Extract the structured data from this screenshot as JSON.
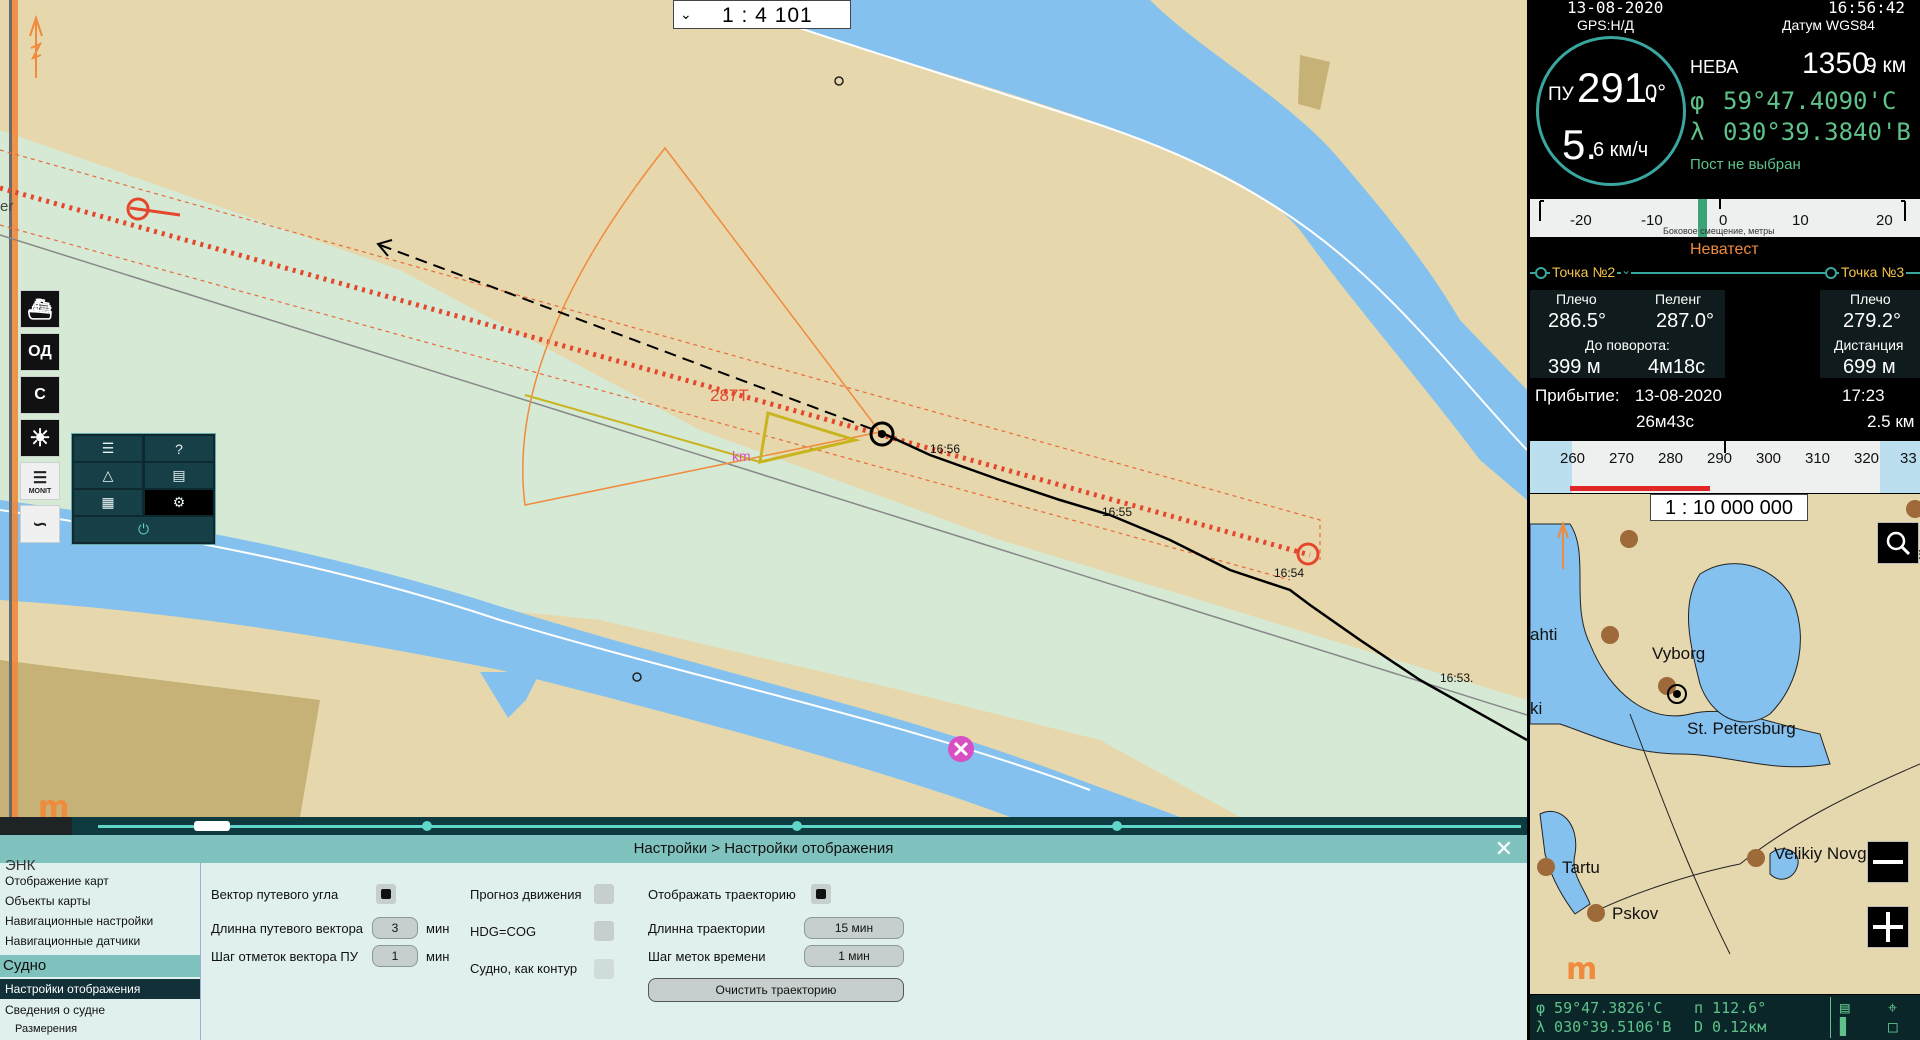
{
  "chart": {
    "scale": "1 : 4 101",
    "bearing_label": "287T",
    "km_label": "km",
    "edge_label": "er",
    "time_labels": [
      "16:56",
      "16:55",
      "16:54",
      "16:53."
    ],
    "logo": "m"
  },
  "left_tools": [
    {
      "name": "ship-view-button",
      "label": "",
      "icon": "ship-icon"
    },
    {
      "name": "od-button",
      "label": "ОД",
      "icon": ""
    },
    {
      "name": "c-button",
      "label": "С",
      "icon": ""
    },
    {
      "name": "day-night-button",
      "label": "",
      "icon": "sun-icon"
    },
    {
      "name": "monit-button",
      "label": "MONIT",
      "icon": "map-book-icon"
    },
    {
      "name": "tide-button",
      "label": "",
      "icon": "curve-icon"
    }
  ],
  "mini_panel": {
    "help_label": "?",
    "items": [
      "list-icon",
      "help-icon",
      "triangle-icon",
      "map-layers-icon",
      "map-tools-icon",
      "settings-icon",
      "power-icon"
    ]
  },
  "settings": {
    "title": "Настройки > Настройки отображения",
    "menu_cut": "ЭНК",
    "menu": [
      "Отображение карт",
      "Объекты карты",
      "Навигационные настройки",
      "Навигационные датчики"
    ],
    "section": "Судно",
    "selected": "Настройки отображения",
    "sub": [
      "Сведения о судне",
      "Размерения"
    ],
    "vector_label": "Вектор путевого угла",
    "vector_on": true,
    "vector_len_label": "Длинна путевого вектора",
    "vector_len_value": "3",
    "vector_len_unit": "мин",
    "vector_step_label": "Шаг отметок вектора ПУ",
    "vector_step_value": "1",
    "vector_step_unit": "мин",
    "forecast_label": "Прогноз движения",
    "hdg_label": "HDG=COG",
    "contour_label": "Судно, как контур",
    "track_label": "Отображать траекторию",
    "track_on": true,
    "track_len_label": "Длинна траектории",
    "track_len_value": "15 мин",
    "time_step_label": "Шаг меток времени",
    "time_step_value": "1 мин",
    "clear_label": "Очистить траекторию"
  },
  "nav": {
    "date": "13-08-2020",
    "time": "16:56:42",
    "gps": "GPS:Н/Д",
    "datum": "Датум WGS84",
    "pu_label": "ПУ",
    "course": "291.",
    "course_dec": "0°",
    "speed": "5.",
    "speed_dec": "6 км/ч",
    "river": "НЕВА",
    "river_km": "1350.",
    "river_km_dec": "9 км",
    "lat_sym": "φ",
    "lat": "59°47.4090'С",
    "lon_sym": "λ",
    "lon": "030°39.3840'В",
    "post": "Пост не выбран",
    "xte_ticks": [
      "-20",
      "-10",
      "0",
      "10",
      "20"
    ],
    "xte_caption": "Боковое смещение, метры",
    "route_name": "Неватест",
    "wp_current": "Точка №2",
    "wp_next": "Точка №3",
    "leg_label": "Плечо",
    "leg_value": "286.5°",
    "bearing_label": "Пеленг",
    "bearing_value": "287.0°",
    "turn_label": "До поворота:",
    "turn_dist": "399 м",
    "turn_time": "4м18с",
    "next_leg_label": "Плечо",
    "next_leg_value": "279.2°",
    "dist_label": "Дистанция",
    "dist_value": "699 м",
    "arrival_label": "Прибытие:",
    "arrival_date": "13-08-2020",
    "arrival_time": "17:23",
    "arrival_remaining": "26м43с",
    "arrival_dist": "2.5 км",
    "heading_ticks": [
      "260",
      "270",
      "280",
      "290",
      "300",
      "310",
      "320",
      "33"
    ]
  },
  "overview": {
    "scale": "1 : 10 000 000",
    "cities": [
      "Vyborg",
      "St. Petersburg",
      "Tartu",
      "Pskov",
      "Velikiy Novgorod"
    ],
    "edge_texts": [
      "ahti",
      "ki",
      "Pe"
    ],
    "logo": "m"
  },
  "status": {
    "lat": "φ  59°47.3826'С",
    "lon": "λ 030°39.5106'В",
    "bearing": "п 112.6°",
    "dist": "D 0.12км"
  }
}
